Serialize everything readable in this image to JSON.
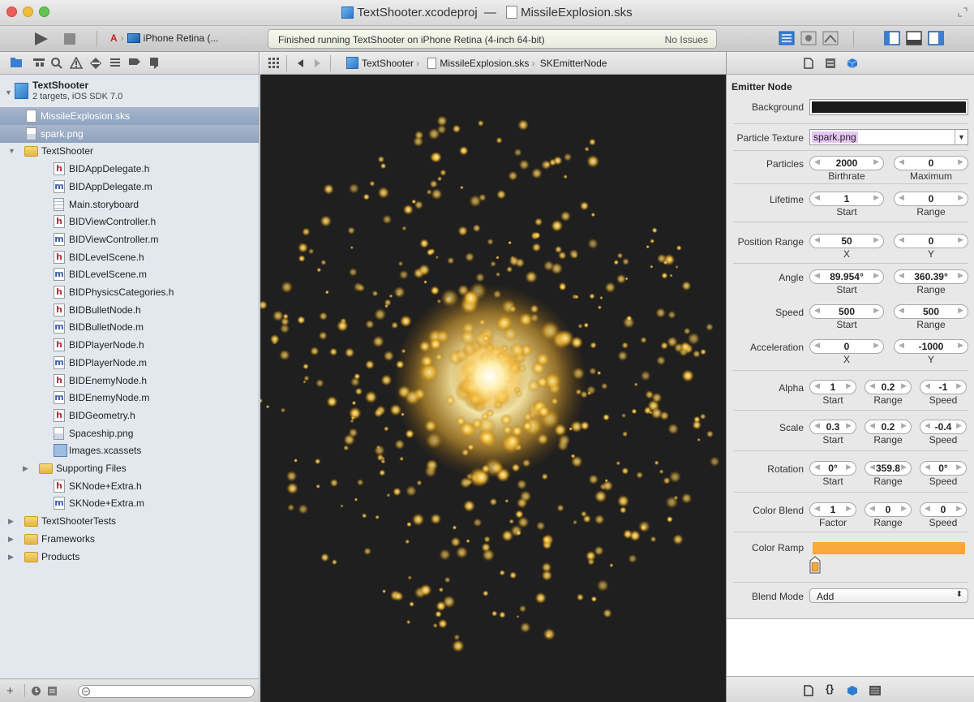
{
  "window": {
    "title_project": "TextShooter.xcodeproj",
    "title_dash": "—",
    "title_file": "MissileExplosion.sks"
  },
  "toolbar": {
    "scheme": "iPhone Retina (...",
    "activity_message": "Finished running TextShooter on iPhone Retina (4-inch 64-bit)",
    "issues": "No Issues"
  },
  "navigator": {
    "project": {
      "name": "TextShooter",
      "subtitle": "2 targets, iOS SDK 7.0"
    },
    "rows": [
      {
        "label": "MissileExplosion.sks",
        "icon": "generic-file-icon",
        "indent": 1,
        "selected": true
      },
      {
        "label": "spark.png",
        "icon": "image-file-icon",
        "indent": 1,
        "selected": true
      },
      {
        "label": "TextShooter",
        "icon": "folder-icon",
        "indent": 1,
        "disclosure": "open"
      },
      {
        "label": "BIDAppDelegate.h",
        "icon": "h",
        "indent": 2
      },
      {
        "label": "BIDAppDelegate.m",
        "icon": "m",
        "indent": 2
      },
      {
        "label": "Main.storyboard",
        "icon": "storyboard-icon",
        "indent": 2
      },
      {
        "label": "BIDViewController.h",
        "icon": "h",
        "indent": 2
      },
      {
        "label": "BIDViewController.m",
        "icon": "m",
        "indent": 2
      },
      {
        "label": "BIDLevelScene.h",
        "icon": "h",
        "indent": 2
      },
      {
        "label": "BIDLevelScene.m",
        "icon": "m",
        "indent": 2
      },
      {
        "label": "BIDPhysicsCategories.h",
        "icon": "h",
        "indent": 2
      },
      {
        "label": "BIDBulletNode.h",
        "icon": "h",
        "indent": 2
      },
      {
        "label": "BIDBulletNode.m",
        "icon": "m",
        "indent": 2
      },
      {
        "label": "BIDPlayerNode.h",
        "icon": "h",
        "indent": 2
      },
      {
        "label": "BIDPlayerNode.m",
        "icon": "m",
        "indent": 2
      },
      {
        "label": "BIDEnemyNode.h",
        "icon": "h",
        "indent": 2
      },
      {
        "label": "BIDEnemyNode.m",
        "icon": "m",
        "indent": 2
      },
      {
        "label": "BIDGeometry.h",
        "icon": "h",
        "indent": 2
      },
      {
        "label": "Spaceship.png",
        "icon": "image-file-icon",
        "indent": 2
      },
      {
        "label": "Images.xcassets",
        "icon": "assets-icon",
        "indent": 2
      },
      {
        "label": "Supporting Files",
        "icon": "folder-icon",
        "indent": 2,
        "disclosure": "closed"
      },
      {
        "label": "SKNode+Extra.h",
        "icon": "h",
        "indent": 2
      },
      {
        "label": "SKNode+Extra.m",
        "icon": "m",
        "indent": 2
      },
      {
        "label": "TextShooterTests",
        "icon": "folder-icon",
        "indent": 1,
        "disclosure": "closed"
      },
      {
        "label": "Frameworks",
        "icon": "folder-icon",
        "indent": 1,
        "disclosure": "closed"
      },
      {
        "label": "Products",
        "icon": "folder-icon",
        "indent": 1,
        "disclosure": "closed"
      }
    ]
  },
  "jumpbar": {
    "crumbs": [
      "TextShooter",
      "MissileExplosion.sks",
      "SKEmitterNode"
    ]
  },
  "inspector": {
    "section_title": "Emitter Node",
    "background_label": "Background",
    "background_color": "#1b1b1b",
    "texture_label": "Particle Texture",
    "texture_value": "spark.png",
    "particles": {
      "label": "Particles",
      "values": [
        "2000",
        "0"
      ],
      "subs": [
        "Birthrate",
        "Maximum"
      ]
    },
    "lifetime": {
      "label": "Lifetime",
      "values": [
        "1",
        "0"
      ],
      "subs": [
        "Start",
        "Range"
      ]
    },
    "position": {
      "label": "Position Range",
      "values": [
        "50",
        "0"
      ],
      "subs": [
        "X",
        "Y"
      ]
    },
    "angle": {
      "label": "Angle",
      "values": [
        "89.954°",
        "360.39°"
      ],
      "subs": [
        "Start",
        "Range"
      ]
    },
    "speed": {
      "label": "Speed",
      "values": [
        "500",
        "500"
      ],
      "subs": [
        "Start",
        "Range"
      ]
    },
    "acceleration": {
      "label": "Acceleration",
      "values": [
        "0",
        "-1000"
      ],
      "subs": [
        "X",
        "Y"
      ]
    },
    "alpha": {
      "label": "Alpha",
      "values": [
        "1",
        "0.2",
        "-1"
      ],
      "subs": [
        "Start",
        "Range",
        "Speed"
      ]
    },
    "scale": {
      "label": "Scale",
      "values": [
        "0.3",
        "0.2",
        "-0.4"
      ],
      "subs": [
        "Start",
        "Range",
        "Speed"
      ]
    },
    "rotation": {
      "label": "Rotation",
      "values": [
        "0°",
        "359.8",
        "0°"
      ],
      "subs": [
        "Start",
        "Range",
        "Speed"
      ]
    },
    "colorblend": {
      "label": "Color Blend",
      "values": [
        "1",
        "0",
        "0"
      ],
      "subs": [
        "Factor",
        "Range",
        "Speed"
      ]
    },
    "colorramp_label": "Color Ramp",
    "colorramp_color": "#f7a93a",
    "blendmode_label": "Blend Mode",
    "blendmode_value": "Add"
  }
}
